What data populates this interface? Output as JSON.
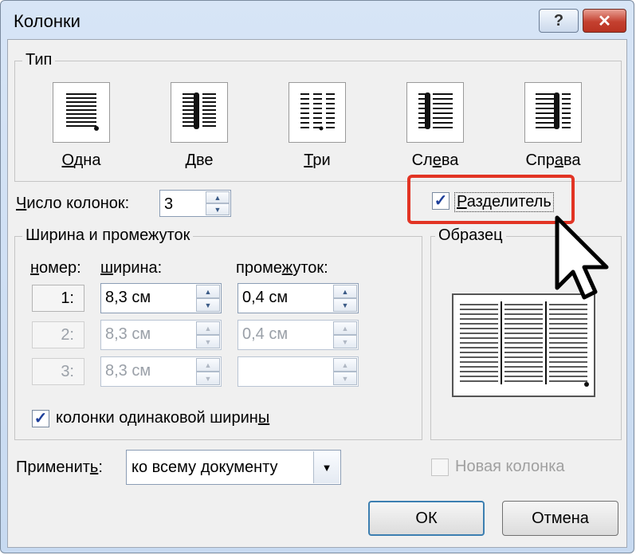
{
  "dialog": {
    "title": "Колонки",
    "help_label": "?",
    "close_label": "✕"
  },
  "presets": {
    "group_label": "Тип",
    "items": [
      {
        "label_u": "О",
        "label_rest": "дна"
      },
      {
        "label_u": "Д",
        "label_rest": "ве"
      },
      {
        "label_u": "Т",
        "label_rest": "ри"
      },
      {
        "label_pre": "Сл",
        "label_u": "е",
        "label_rest": "ва"
      },
      {
        "label_pre": "Спр",
        "label_u": "а",
        "label_rest": "ва"
      }
    ]
  },
  "count": {
    "label_u": "Ч",
    "label_rest": "исло колонок:",
    "value": "3"
  },
  "separator": {
    "label_u": "Р",
    "label_rest": "азделитель",
    "checked": "✓"
  },
  "width_spacing": {
    "group_label": "Ширина и промежуток",
    "col_number_header_u": "н",
    "col_number_header_rest": "омер:",
    "col_width_header_u": "ш",
    "col_width_header_rest": "ирина:",
    "col_spacing_header_pre": "проме",
    "col_spacing_header_u": "ж",
    "col_spacing_header_rest": "уток:",
    "rows": [
      {
        "number": "1:",
        "width": "8,3 см",
        "spacing": "0,4 см"
      },
      {
        "number": "2:",
        "width": "8,3 см",
        "spacing": "0,4 см"
      },
      {
        "number": "3:",
        "width": "8,3 см",
        "spacing": ""
      }
    ],
    "equal_width": {
      "label_pre": "колонки одинаковой ширин",
      "label_u": "ы",
      "checked": "✓"
    }
  },
  "sample": {
    "label": "Образец"
  },
  "apply": {
    "label_pre": "Применит",
    "label_u": "ь",
    "label_rest": ":",
    "value": "ко всему документу",
    "drop_icon": "▼"
  },
  "new_column": {
    "label": "Новая колонка"
  },
  "buttons": {
    "ok": "ОК",
    "cancel": "Отмена"
  },
  "colors": {
    "highlight": "#e23424",
    "check_mark": "#1e3f9a"
  }
}
